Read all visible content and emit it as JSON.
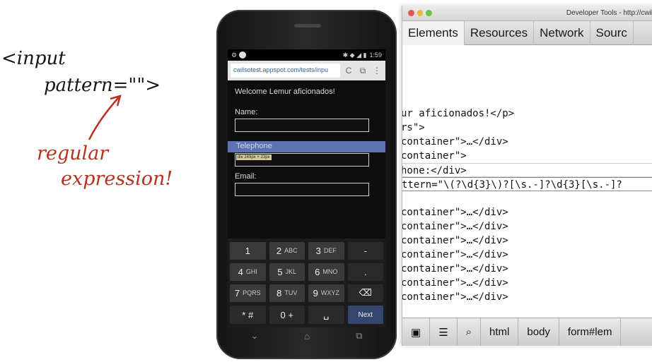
{
  "annotation": {
    "code_line1": "<input",
    "code_line2": "pattern=\"\">",
    "note_line1": "regular",
    "note_line2": "expression!"
  },
  "phone": {
    "status": {
      "time": "1:59",
      "left_icons": "⚙ ⚪",
      "right_icons": "✱ ◆ ◢ ▮"
    },
    "browser": {
      "url": "cwilsotest.appspot.com/tests/inpu",
      "reload_glyph": "C",
      "tabs_glyph": "⧉",
      "menu_glyph": "⋮"
    },
    "form": {
      "welcome": "Welcome Lemur aficionados!",
      "name_label": "Name:",
      "telephone_label": "Telephone",
      "tooltip": "div 249px × 23px",
      "email_label": "Email:"
    },
    "keyboard": {
      "keys": [
        {
          "main": "1",
          "sub": ""
        },
        {
          "main": "2",
          "sub": "ABC"
        },
        {
          "main": "3",
          "sub": "DEF"
        },
        {
          "main": "-",
          "sub": ""
        },
        {
          "main": "4",
          "sub": "GHI"
        },
        {
          "main": "5",
          "sub": "JKL"
        },
        {
          "main": "6",
          "sub": "MNO"
        },
        {
          "main": ".",
          "sub": ""
        },
        {
          "main": "7",
          "sub": "PQRS"
        },
        {
          "main": "8",
          "sub": "TUV"
        },
        {
          "main": "9",
          "sub": "WXYZ"
        },
        {
          "main": "⌫",
          "sub": ""
        },
        {
          "main": "* #",
          "sub": ""
        },
        {
          "main": "0 +",
          "sub": ""
        },
        {
          "main": "␣",
          "sub": ""
        },
        {
          "main": "Next",
          "sub": ""
        }
      ]
    },
    "nav": {
      "back": "⌄",
      "home": "⌂",
      "recent": "⧉"
    }
  },
  "devtools": {
    "title": "Developer Tools - http://cwils",
    "tabs": [
      "Elements",
      "Resources",
      "Network",
      "Sourc"
    ],
    "dom_lines": [
      "ur aficionados!</p>",
      "rs\">",
      "container\">…</div>",
      "container\">",
      "hone:</div>",
      "ttern=\"\\(?\\d{3}\\)?[\\s.-]?\\d{3}[\\s.-]?",
      "",
      "container\">…</div>",
      "container\">…</div>",
      "container\">…</div>",
      "container\">…</div>",
      "container\">…</div>",
      "container\">…</div>",
      "container\">…</div>"
    ],
    "bottom": {
      "dock_glyph": "▣",
      "console_glyph": "☰",
      "search_glyph": "⌕",
      "crumbs": [
        "html",
        "body",
        "form#lem"
      ]
    }
  }
}
